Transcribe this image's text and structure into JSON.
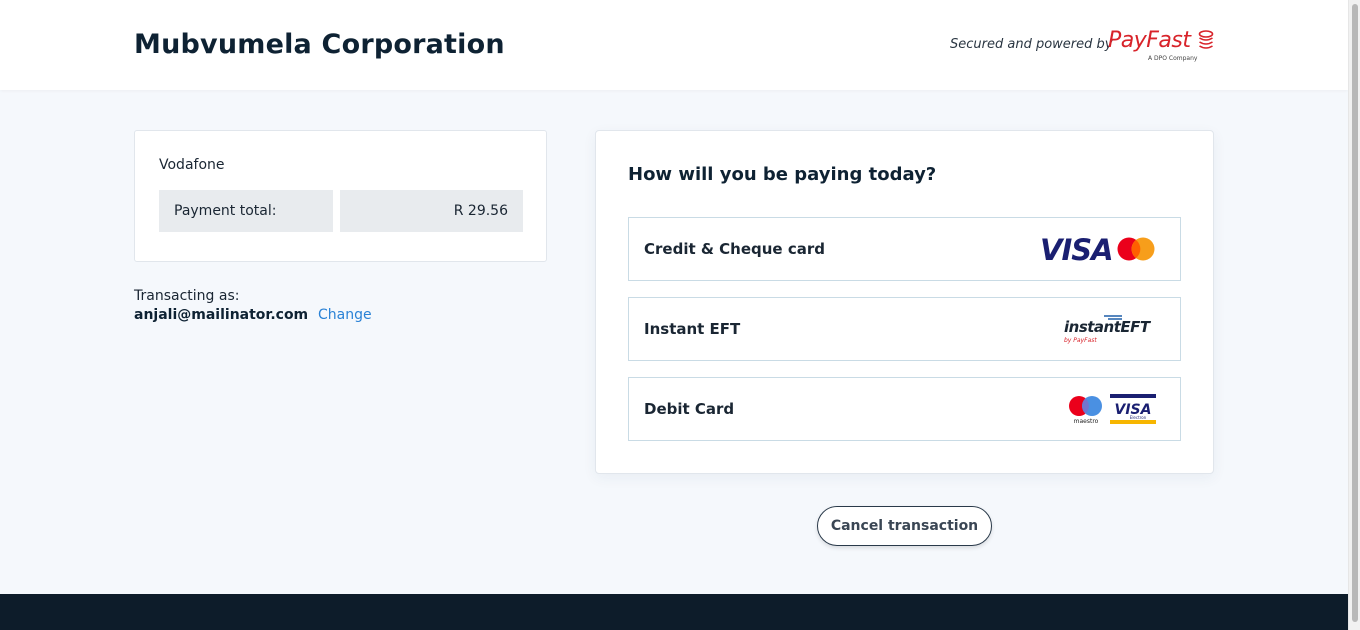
{
  "header": {
    "merchant_name": "Mubvumela Corporation",
    "secured_text": "Secured and powered by",
    "brand": "PayFast",
    "brand_tagline": "A DPO Company"
  },
  "order": {
    "item": "Vodafone",
    "total_label": "Payment total:",
    "total_value": "R 29.56"
  },
  "account": {
    "label": "Transacting as:",
    "email": "anjali@mailinator.com",
    "change_label": "Change"
  },
  "payment": {
    "title": "How will you be paying today?",
    "methods": [
      {
        "label": "Credit & Cheque card",
        "icons": [
          "visa-logo",
          "mastercard-logo"
        ]
      },
      {
        "label": "Instant EFT",
        "icons": [
          "instant-eft-logo"
        ],
        "logo_text": "instantEFT",
        "logo_sub": "by PayFast"
      },
      {
        "label": "Debit Card",
        "icons": [
          "maestro-logo",
          "visa-electron-logo"
        ],
        "maestro_text": "maestro",
        "visa_text": "VISA",
        "visa_sub": "Electron"
      }
    ],
    "visa_text": "VISA"
  },
  "actions": {
    "cancel_label": "Cancel transaction"
  },
  "colors": {
    "brand_red": "#d8232a",
    "link_blue": "#2a82d6",
    "footer_navy": "#0d1c2a",
    "visa_navy": "#1a1f71",
    "mastercard_red": "#eb001b",
    "mastercard_orange": "#f79e1b"
  }
}
